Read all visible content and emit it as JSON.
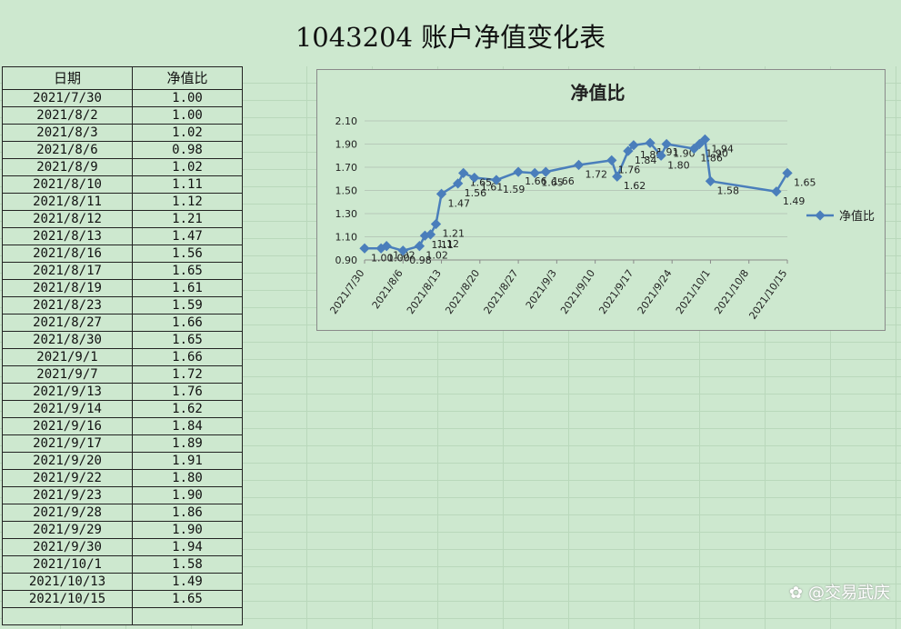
{
  "sheet": {
    "title": "1043204 账户净值变化表",
    "headers": [
      "日期",
      "净值比"
    ],
    "rows": [
      [
        "2021/7/30",
        "1.00"
      ],
      [
        "2021/8/2",
        "1.00"
      ],
      [
        "2021/8/3",
        "1.02"
      ],
      [
        "2021/8/6",
        "0.98"
      ],
      [
        "2021/8/9",
        "1.02"
      ],
      [
        "2021/8/10",
        "1.11"
      ],
      [
        "2021/8/11",
        "1.12"
      ],
      [
        "2021/8/12",
        "1.21"
      ],
      [
        "2021/8/13",
        "1.47"
      ],
      [
        "2021/8/16",
        "1.56"
      ],
      [
        "2021/8/17",
        "1.65"
      ],
      [
        "2021/8/19",
        "1.61"
      ],
      [
        "2021/8/23",
        "1.59"
      ],
      [
        "2021/8/27",
        "1.66"
      ],
      [
        "2021/8/30",
        "1.65"
      ],
      [
        "2021/9/1",
        "1.66"
      ],
      [
        "2021/9/7",
        "1.72"
      ],
      [
        "2021/9/13",
        "1.76"
      ],
      [
        "2021/9/14",
        "1.62"
      ],
      [
        "2021/9/16",
        "1.84"
      ],
      [
        "2021/9/17",
        "1.89"
      ],
      [
        "2021/9/20",
        "1.91"
      ],
      [
        "2021/9/22",
        "1.80"
      ],
      [
        "2021/9/23",
        "1.90"
      ],
      [
        "2021/9/28",
        "1.86"
      ],
      [
        "2021/9/29",
        "1.90"
      ],
      [
        "2021/9/30",
        "1.94"
      ],
      [
        "2021/10/1",
        "1.58"
      ],
      [
        "2021/10/13",
        "1.49"
      ],
      [
        "2021/10/15",
        "1.65"
      ]
    ]
  },
  "chart_data": {
    "type": "line",
    "title": "净值比",
    "xlabel": "",
    "ylabel": "",
    "x": [
      "2021/7/30",
      "2021/8/2",
      "2021/8/3",
      "2021/8/6",
      "2021/8/9",
      "2021/8/10",
      "2021/8/11",
      "2021/8/12",
      "2021/8/13",
      "2021/8/16",
      "2021/8/17",
      "2021/8/19",
      "2021/8/23",
      "2021/8/27",
      "2021/8/30",
      "2021/9/1",
      "2021/9/7",
      "2021/9/13",
      "2021/9/14",
      "2021/9/16",
      "2021/9/17",
      "2021/9/20",
      "2021/9/22",
      "2021/9/23",
      "2021/9/28",
      "2021/9/29",
      "2021/9/30",
      "2021/10/1",
      "2021/10/13",
      "2021/10/15"
    ],
    "series": [
      {
        "name": "净值比",
        "values": [
          1.0,
          1.0,
          1.02,
          0.98,
          1.02,
          1.11,
          1.12,
          1.21,
          1.47,
          1.56,
          1.65,
          1.61,
          1.59,
          1.66,
          1.65,
          1.66,
          1.72,
          1.76,
          1.62,
          1.84,
          1.89,
          1.91,
          1.8,
          1.9,
          1.86,
          1.9,
          1.94,
          1.58,
          1.49,
          1.65
        ]
      }
    ],
    "ylim": [
      0.9,
      2.1
    ],
    "y_ticks": [
      "0.90",
      "1.10",
      "1.30",
      "1.50",
      "1.70",
      "1.90",
      "2.10"
    ],
    "x_ticks": [
      "2021/7/30",
      "2021/8/6",
      "2021/8/13",
      "2021/8/20",
      "2021/8/27",
      "2021/9/3",
      "2021/9/10",
      "2021/9/17",
      "2021/9/24",
      "2021/10/1",
      "2021/10/8",
      "2021/10/15"
    ],
    "grid": true,
    "legend": "right",
    "color": "#4a7ebb"
  },
  "watermark": "@交易武庆"
}
